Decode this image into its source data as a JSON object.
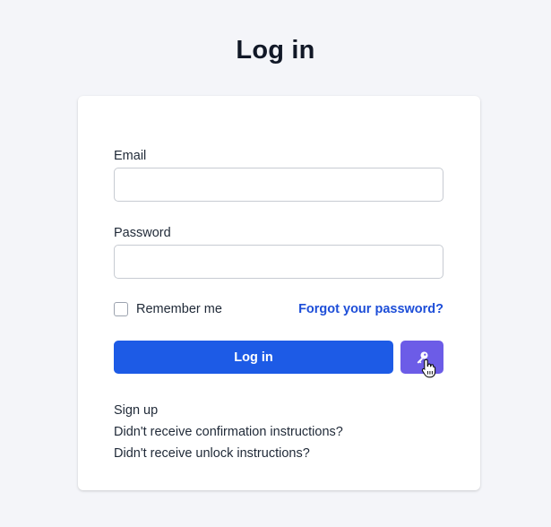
{
  "page": {
    "title": "Log in"
  },
  "form": {
    "email_label": "Email",
    "email_value": "",
    "password_label": "Password",
    "password_value": "",
    "remember_label": "Remember me",
    "remember_checked": false,
    "forgot_link": "Forgot your password?",
    "submit_label": "Log in",
    "passkey_icon": "key-icon"
  },
  "links": [
    "Sign up",
    "Didn't receive confirmation instructions?",
    "Didn't receive unlock instructions?"
  ],
  "colors": {
    "background": "#f4f5f9",
    "primary_button": "#1d5be6",
    "passkey_button": "#6c5ce7",
    "link": "#1d4ed8"
  }
}
